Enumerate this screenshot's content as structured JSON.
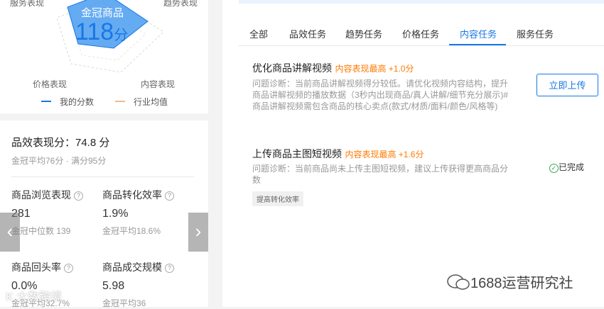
{
  "radar": {
    "axes": {
      "top_left": "服务表现",
      "top_right": "趋势表现",
      "bottom_left": "价格表现",
      "bottom_right": "内容表现"
    },
    "center_title": "金冠商品",
    "score": "118",
    "score_unit": "分",
    "legend": {
      "mine": "我的分数",
      "industry": "行业均值"
    },
    "colors": {
      "mine": "#1877e6",
      "industry": "#f2b88a"
    }
  },
  "summary": {
    "title": "品效表现分：74.8 分",
    "subtitle": "金冠平均76分 · 满分95分"
  },
  "metrics": [
    {
      "title": "商品浏览表现",
      "value": "281",
      "sub": "金冠中位数 139"
    },
    {
      "title": "商品转化效率",
      "value": "1.9%",
      "sub": "金冠平均18.6%"
    },
    {
      "title": "商品回头率",
      "value": "0.0%",
      "sub": "金冠平均32.7%"
    },
    {
      "title": "商品成交规模",
      "value": "5.98",
      "sub": "金冠平均36"
    }
  ],
  "nav": {
    "prev": "‹",
    "next": "›"
  },
  "tabs": [
    "全部",
    "品效任务",
    "趋势任务",
    "价格任务",
    "内容任务",
    "服务任务"
  ],
  "active_tab": "内容任务",
  "tasks": [
    {
      "title": "优化商品讲解视频",
      "tag": "内容表现最高 +1.0分",
      "desc": "问题诊断：当前商品讲解视频得分较低。请优化视频内容结构，提升商品讲解视频的播放数据（3秒内出现商品/真人讲解/细节充分展示)#商品讲解视频需包含商品的核心卖点(款式/材质/面料/颜色/风格等)",
      "action": "立即上传"
    },
    {
      "title": "上传商品主图短视频",
      "tag": "内容表现最高 +1.6分",
      "desc": "问题诊断：当前商品尚未上传主图短视频，建议上传获得更高商品分数",
      "status": "已完成",
      "chip": "提高转化效率"
    }
  ],
  "watermark": "1688运营研究社",
  "watermark_left": "K 大数跨境"
}
